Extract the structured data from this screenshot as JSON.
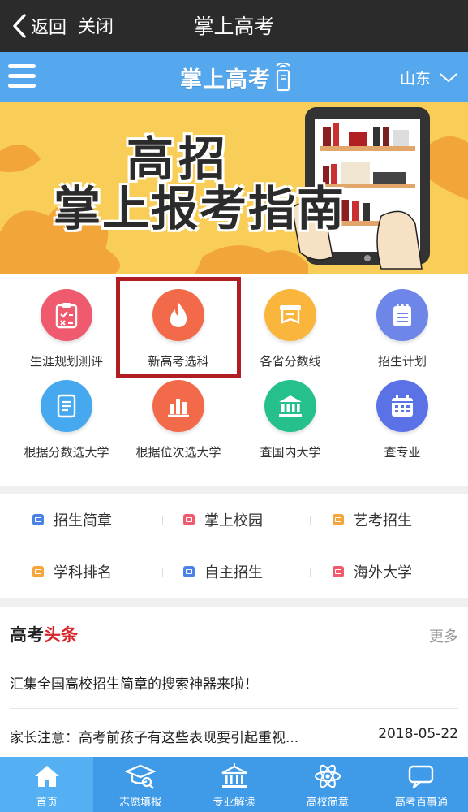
{
  "topbar": {
    "back_label": "返回",
    "close_label": "关闭",
    "title": "掌上高考"
  },
  "header": {
    "logo_text": "掌上高考",
    "region": "山东"
  },
  "banner": {
    "line1": "高招",
    "line2": "掌上报考指南"
  },
  "grid": [
    {
      "label": "生涯规划测评",
      "color": "#f05a6e",
      "icon": "clipboard-check-icon"
    },
    {
      "label": "新高考选科",
      "color": "#f36a4a",
      "icon": "flame-icon"
    },
    {
      "label": "各省分数线",
      "color": "#f9b53c",
      "icon": "scroll-icon"
    },
    {
      "label": "招生计划",
      "color": "#6e86e8",
      "icon": "notepad-icon"
    },
    {
      "label": "根据分数选大学",
      "color": "#46a8ef",
      "icon": "document-icon"
    },
    {
      "label": "根据位次选大学",
      "color": "#f36a4a",
      "icon": "bar-chart-icon"
    },
    {
      "label": "查国内大学",
      "color": "#26c08c",
      "icon": "university-icon"
    },
    {
      "label": "查专业",
      "color": "#5b72e6",
      "icon": "calendar-grid-icon"
    }
  ],
  "links": [
    {
      "label": "招生简章",
      "color": "#4b82e6"
    },
    {
      "label": "掌上校园",
      "color": "#f05a6e"
    },
    {
      "label": "艺考招生",
      "color": "#f5a53c"
    },
    {
      "label": "学科排名",
      "color": "#f5a53c"
    },
    {
      "label": "自主招生",
      "color": "#4b82e6"
    },
    {
      "label": "海外大学",
      "color": "#f05a6e"
    }
  ],
  "news": {
    "heading_black": "高考",
    "heading_red": "头条",
    "more_label": "更多",
    "items": [
      {
        "title": "汇集全国高校招生简章的搜索神器来啦！",
        "date": ""
      },
      {
        "title": "家长注意：高考前孩子有这些表现要引起重视...",
        "date": "2018-05-22"
      }
    ]
  },
  "tabs": [
    {
      "label": "首页",
      "icon": "home-icon",
      "active": true
    },
    {
      "label": "志愿填报",
      "icon": "graduation-cap-icon",
      "active": false
    },
    {
      "label": "专业解读",
      "icon": "building-icon",
      "active": false
    },
    {
      "label": "高校简章",
      "icon": "atom-icon",
      "active": false
    },
    {
      "label": "高考百事通",
      "icon": "chat-bubble-icon",
      "active": false
    }
  ],
  "colors": {
    "accent": "#55a8ee",
    "tabbar": "#3f9ae8",
    "highlight": "#b01e23",
    "headline_red": "#d8242b"
  }
}
